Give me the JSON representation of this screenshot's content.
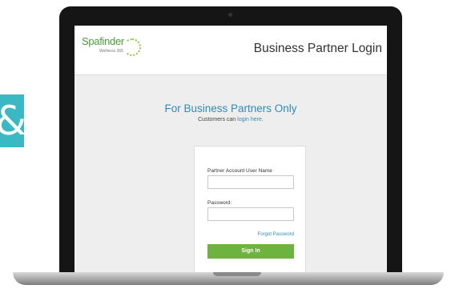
{
  "decoration": {
    "glyph": "&",
    "color": "#3ab8c4"
  },
  "header": {
    "logo_text": "Spafinder",
    "logo_subtext": "Wellness 365",
    "title": "Business Partner Login"
  },
  "promo": {
    "title": "For Business Partners Only",
    "subtitle_prefix": "Customers can",
    "subtitle_link": "login here."
  },
  "login_form": {
    "username_label": "Partner Account User Name",
    "username_value": "",
    "password_label": "Password:",
    "password_value": "",
    "forgot_label": "Forgot Password",
    "signin_label": "Sign In"
  },
  "colors": {
    "accent_blue": "#2f8bb8",
    "signin_green": "#6db33f",
    "brand_green": "#4a9a3a"
  }
}
